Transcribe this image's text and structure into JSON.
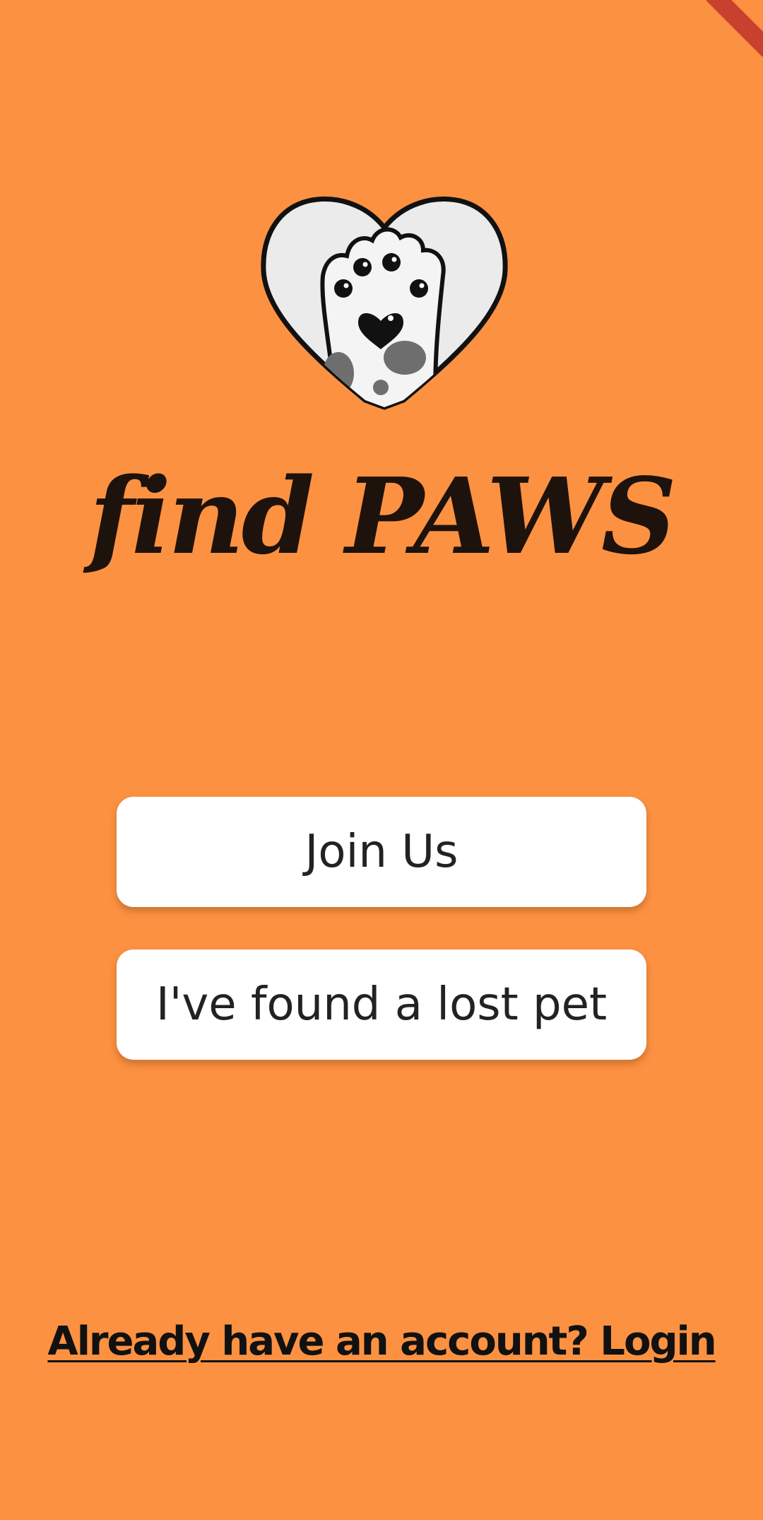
{
  "app": {
    "title": "find PAWS"
  },
  "logo": {
    "icon": "heart-paw-icon"
  },
  "actions": {
    "join_label": "Join Us",
    "found_pet_label": "I've found a lost pet"
  },
  "footer": {
    "login_label": "Already have an account? Login"
  },
  "colors": {
    "background": "#FC9142",
    "button_bg": "#FFFFFF",
    "title_text": "#1E120C",
    "debug_banner": "#C8412E"
  }
}
